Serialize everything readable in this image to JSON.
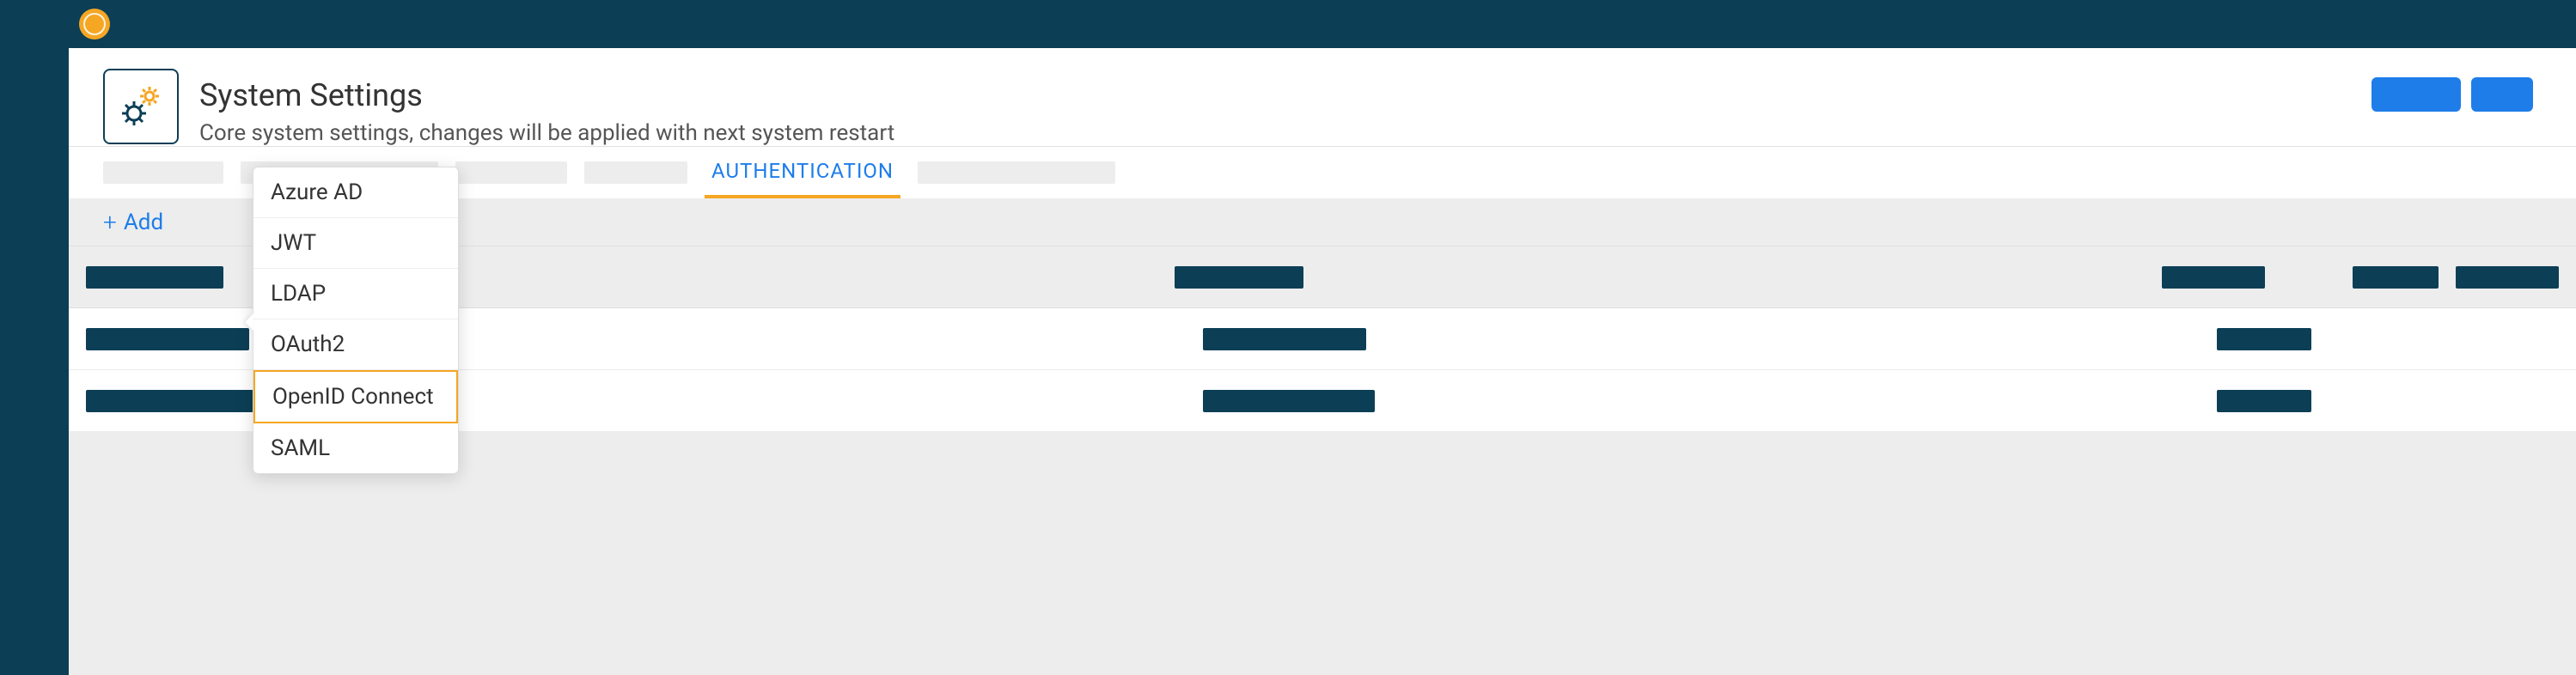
{
  "header": {
    "title": "System Settings",
    "subtitle": "Core system settings, changes will be applied with next system restart"
  },
  "tabs": {
    "active_label": "AUTHENTICATION"
  },
  "add_button_label": "Add",
  "dropdown": {
    "items": [
      {
        "label": "Azure AD",
        "selected": false
      },
      {
        "label": "JWT",
        "selected": false
      },
      {
        "label": "LDAP",
        "selected": false
      },
      {
        "label": "OAuth2",
        "selected": false
      },
      {
        "label": "OpenID Connect",
        "selected": true
      },
      {
        "label": "SAML",
        "selected": false
      }
    ]
  },
  "colors": {
    "brand_dark": "#0c3f56",
    "accent_orange": "#f5a623",
    "primary_blue": "#1e7de9"
  }
}
